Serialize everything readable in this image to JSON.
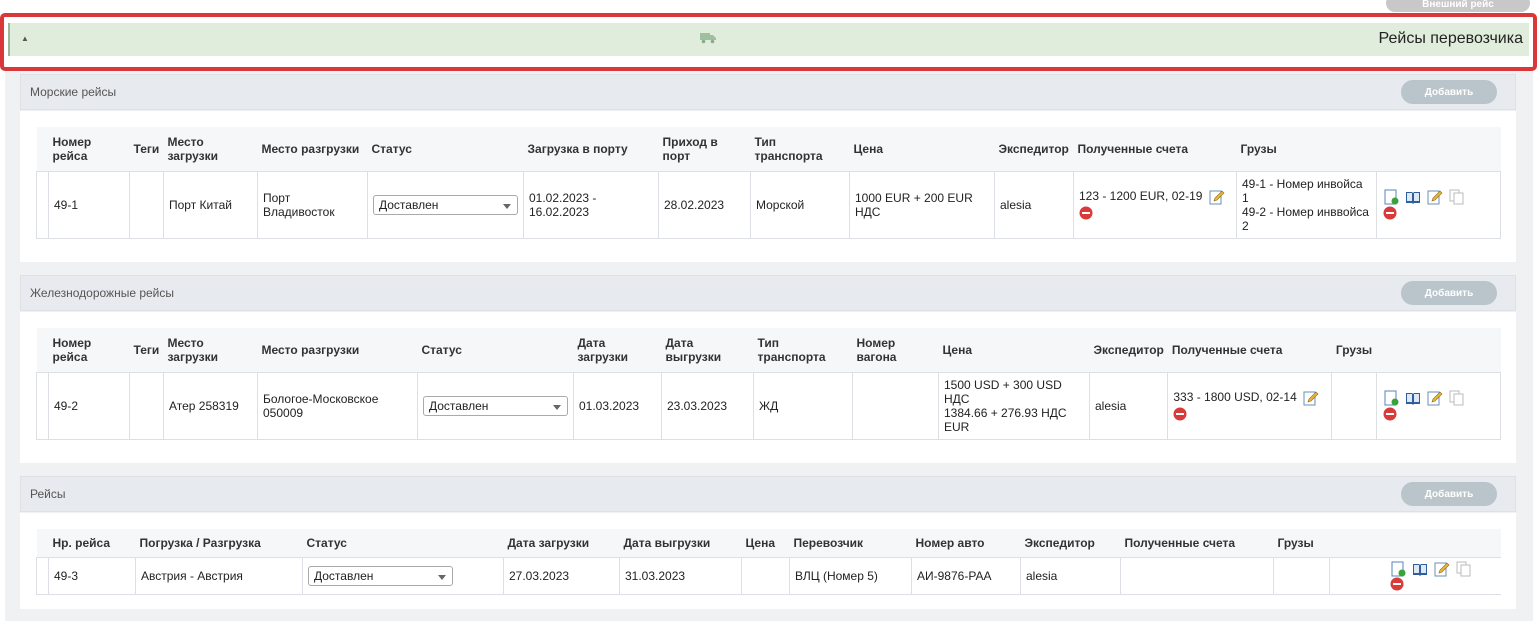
{
  "top_button": "Внешний рейс",
  "carrier": {
    "title": "Рейсы перевозчика"
  },
  "sea": {
    "title": "Морские рейсы",
    "add_label": "Добавить",
    "headers": [
      "Номер рейса",
      "Теги",
      "Место загрузки",
      "Место разгрузки",
      "Статус",
      "Загрузка в порту",
      "Приход в порт",
      "Тип транспорта",
      "Цена",
      "Экспедитор",
      "Полученные счета",
      "Грузы"
    ],
    "row": {
      "number": "49-1",
      "tags": "",
      "load_place": "Порт Китай",
      "unload_place": "Порт Владивосток",
      "status": "Доставлен",
      "port_loading": "01.02.2023 - 16.02.2023",
      "port_arrival": "28.02.2023",
      "transport_type": "Морской",
      "price": "1000 EUR + 200 EUR НДС",
      "forwarder": "alesia",
      "invoices": "123 - 1200 EUR, 02-19",
      "cargo_1": "49-1 - Номер инвойса 1",
      "cargo_2": "49-2 - Номер инввойса 2"
    }
  },
  "rail": {
    "title": "Железнодорожные рейсы",
    "add_label": "Добавить",
    "headers": [
      "Номер рейса",
      "Теги",
      "Место загрузки",
      "Место разгрузки",
      "Статус",
      "Дата загрузки",
      "Дата выгрузки",
      "Тип транспорта",
      "Номер вагона",
      "Цена",
      "Экспедитор",
      "Полученные счета",
      "Грузы"
    ],
    "row": {
      "number": "49-2",
      "tags": "",
      "load_place": "Атер 258319",
      "unload_place": "Бологое-Московское 050009",
      "status": "Доставлен",
      "load_date": "01.03.2023",
      "unload_date": "23.03.2023",
      "transport_type": "ЖД",
      "wagon": "",
      "price_1": "1500 USD + 300 USD НДС",
      "price_2": "1384.66 + 276.93 НДС EUR",
      "forwarder": "alesia",
      "invoices": "333 - 1800 USD, 02-14",
      "cargo": ""
    }
  },
  "trips": {
    "title": "Рейсы",
    "add_label": "Добавить",
    "headers": [
      "Нр. рейса",
      "Погрузка / Разгрузка",
      "Статус",
      "Дата загрузки",
      "Дата выгрузки",
      "Цена",
      "Перевозчик",
      "Номер авто",
      "Экспедитор",
      "Полученные счета",
      "Грузы"
    ],
    "row": {
      "number": "49-3",
      "route": "Австрия - Австрия",
      "status": "Доставлен",
      "load_date": "27.03.2023",
      "unload_date": "31.03.2023",
      "price": "",
      "carrier": "ВЛЦ (Номер 5)",
      "car_number": "АИ-9876-РАА",
      "forwarder": "alesia",
      "invoices": "",
      "cargo": ""
    }
  },
  "icons": [
    "document-add-icon",
    "book-icon",
    "edit-icon",
    "copy-icon",
    "delete-icon",
    "truck-icon",
    "collapse-arrow-icon"
  ],
  "colors": {
    "highlight_border": "#d9373a",
    "carrier_bar_bg": "#e0eddc",
    "add_button_bg": "#b9c4cb",
    "delete_red": "#d93a3a"
  }
}
